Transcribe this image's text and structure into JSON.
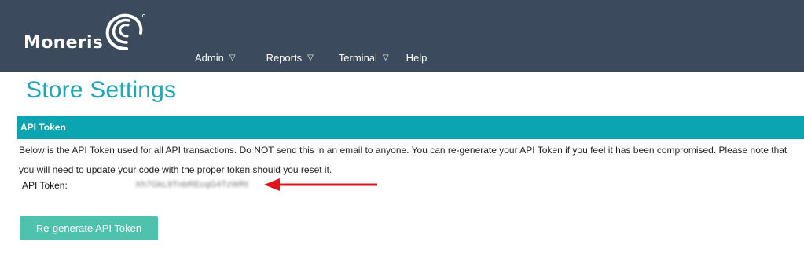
{
  "header": {
    "brand": "Moneris",
    "nav": [
      {
        "label": "Admin",
        "has_menu": true
      },
      {
        "label": "Reports",
        "has_menu": true
      },
      {
        "label": "Terminal",
        "has_menu": true
      },
      {
        "label": "Help",
        "has_menu": false
      }
    ],
    "caret": "▽"
  },
  "page": {
    "title": "Store Settings"
  },
  "api_token_section": {
    "header": "API Token",
    "description": "Below is the API Token used for all API transactions. Do NOT send this in an email to anyone. You can re-generate your API Token if you feel it has been compromised. Please note that you will need to update your code with the proper token should you reset it.",
    "token_label": "API Token:",
    "token_value": "Xh7GkL9TnbREcqG4TzWRt",
    "regenerate_button": "Re-generate API Token"
  },
  "colors": {
    "topbar": "#3b4a5c",
    "title": "#1fa7b4",
    "section_header": "#0ba5b1",
    "button": "#4ec2ad",
    "annotation_arrow": "#e0141b"
  }
}
